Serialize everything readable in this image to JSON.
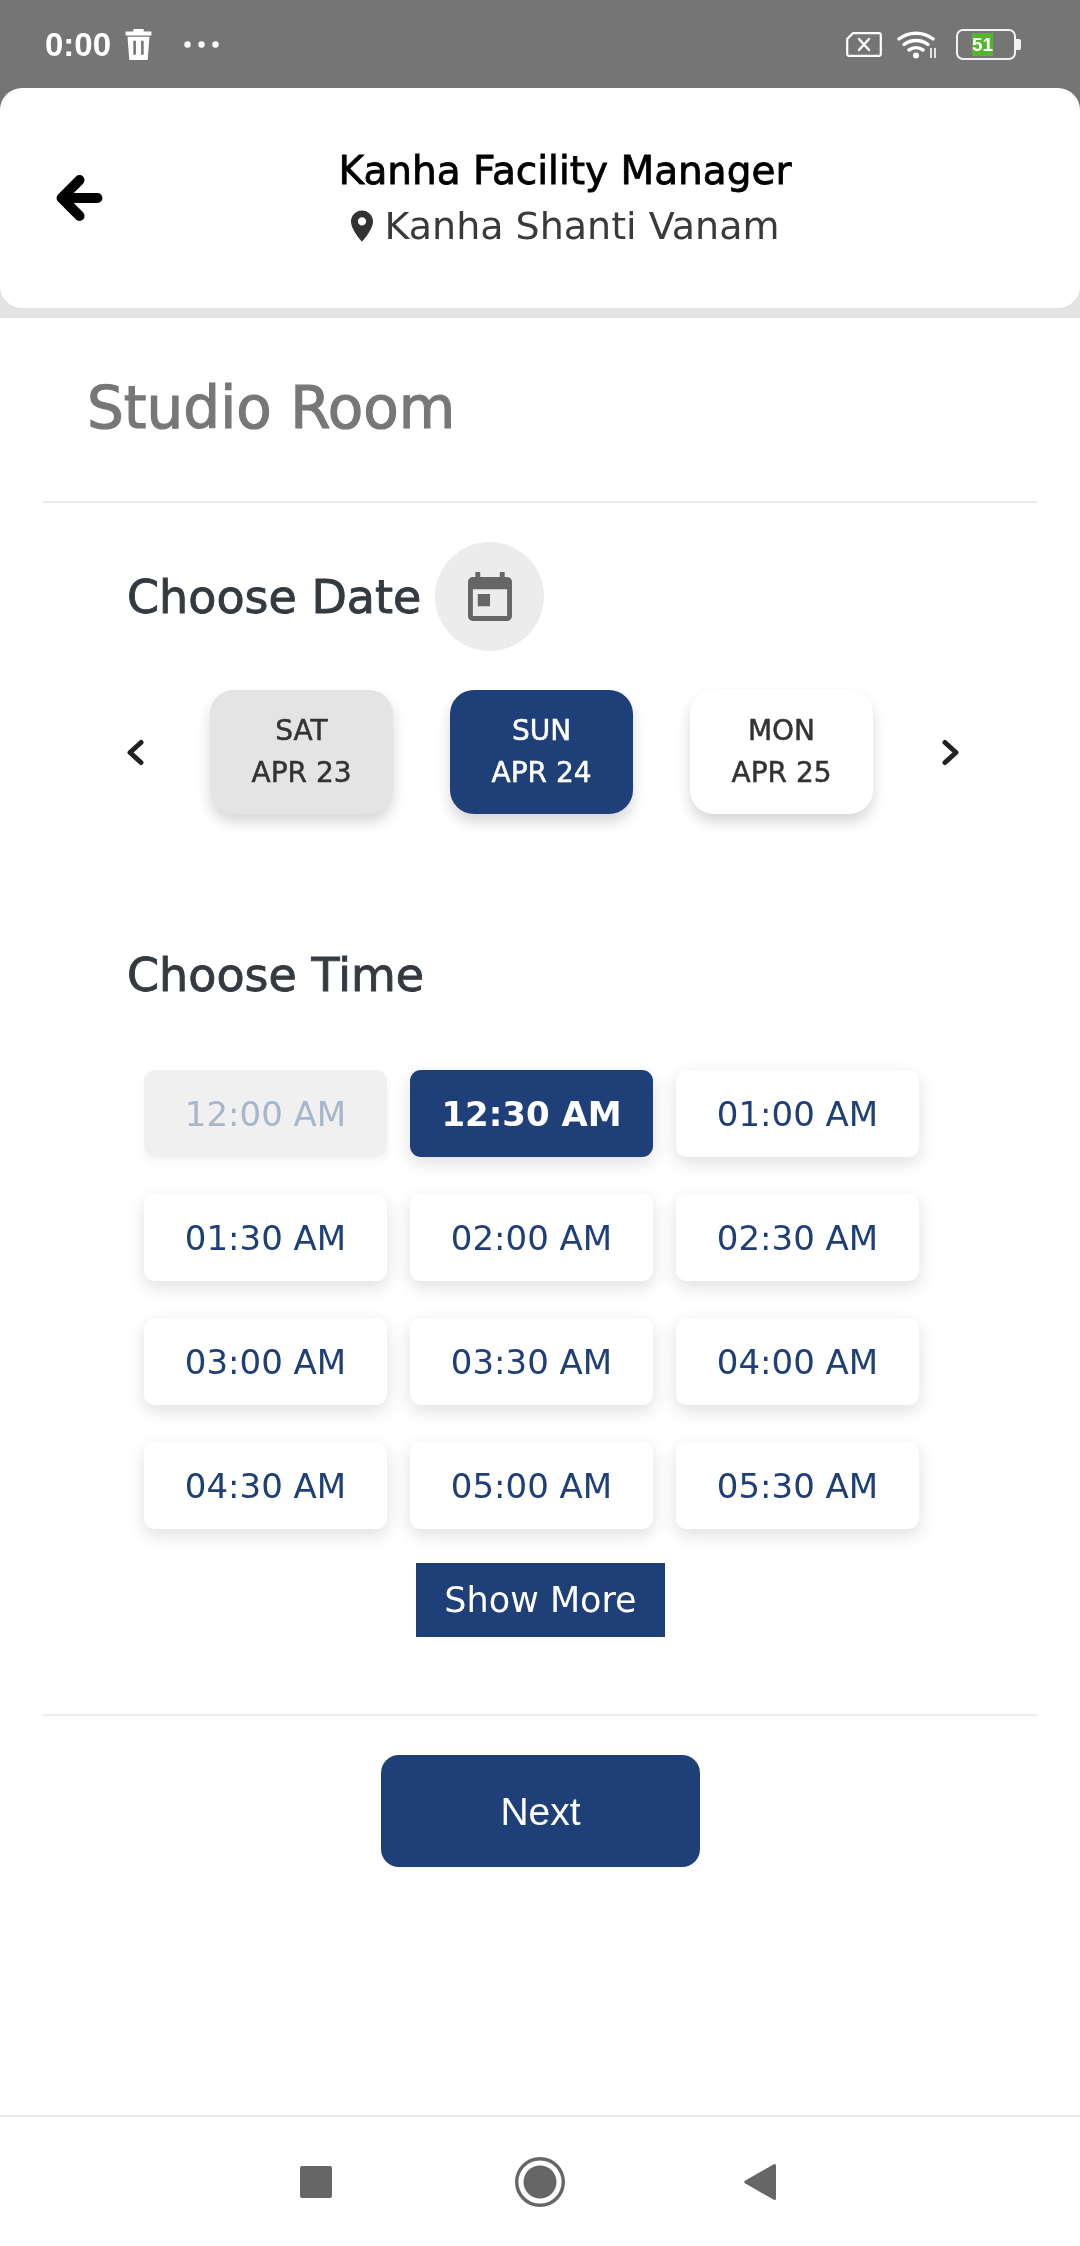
{
  "status_bar": {
    "time": "0:00",
    "battery": "51"
  },
  "header": {
    "title": "Kanha Facility Manager",
    "location": "Kanha Shanti Vanam"
  },
  "room": {
    "title": "Studio Room"
  },
  "date_picker": {
    "label": "Choose Date",
    "dates": [
      {
        "day": "SAT",
        "date": "APR 23",
        "selected": false,
        "disabled": true
      },
      {
        "day": "SUN",
        "date": "APR 24",
        "selected": true,
        "disabled": false
      },
      {
        "day": "MON",
        "date": "APR 25",
        "selected": false,
        "disabled": false
      }
    ]
  },
  "time_picker": {
    "label": "Choose Time",
    "slots": [
      {
        "time": "12:00 AM",
        "selected": false,
        "disabled": true
      },
      {
        "time": "12:30 AM",
        "selected": true,
        "disabled": false
      },
      {
        "time": "01:00 AM",
        "selected": false,
        "disabled": false
      },
      {
        "time": "01:30 AM",
        "selected": false,
        "disabled": false
      },
      {
        "time": "02:00 AM",
        "selected": false,
        "disabled": false
      },
      {
        "time": "02:30 AM",
        "selected": false,
        "disabled": false
      },
      {
        "time": "03:00 AM",
        "selected": false,
        "disabled": false
      },
      {
        "time": "03:30 AM",
        "selected": false,
        "disabled": false
      },
      {
        "time": "04:00 AM",
        "selected": false,
        "disabled": false
      },
      {
        "time": "04:30 AM",
        "selected": false,
        "disabled": false
      },
      {
        "time": "05:00 AM",
        "selected": false,
        "disabled": false
      },
      {
        "time": "05:30 AM",
        "selected": false,
        "disabled": false
      }
    ],
    "show_more": "Show More"
  },
  "next_button": {
    "label": "Next"
  }
}
